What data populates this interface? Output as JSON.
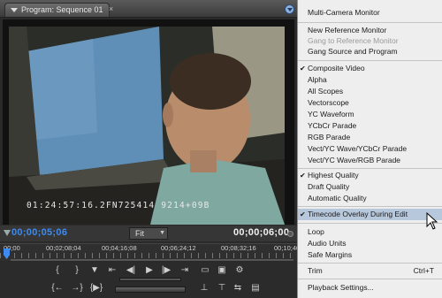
{
  "panel": {
    "tab_label": "Program: Sequence 01",
    "close_glyph": "×"
  },
  "video": {
    "timecode_overlay": "01:24:57:16.2FN725414  9214+09B"
  },
  "time_row": {
    "current_timecode": "00;00;05;06",
    "zoom_value": "Fit",
    "duration_timecode": "00;00;06;00"
  },
  "ruler": {
    "labels": [
      "00;00",
      "00;02;08;04",
      "00;04;16;08",
      "00;06;24;12",
      "00;08;32;16",
      "00;10;40;"
    ]
  },
  "transport": {
    "buttons": {
      "mark_in": "{",
      "mark_out": "}",
      "set_marker": "▼",
      "go_to_in": "⇤",
      "step_back": "◀|",
      "play": "▶",
      "step_forward": "|▶",
      "go_to_out": "⇥",
      "output": "▭",
      "safe_margins": "▣",
      "settings": "⚙",
      "go_prev_marker": "{←",
      "go_next_marker": "→}",
      "play_in_out": "{▶}",
      "loop": "↻",
      "lift": "⊥",
      "extract": "⊤",
      "trim": "⇆",
      "export_frame": "▤"
    }
  },
  "menu": {
    "items": [
      {
        "label": "Multi-Camera Monitor",
        "checked": false,
        "disabled": false
      },
      {
        "label": "New Reference Monitor",
        "checked": false,
        "disabled": false
      },
      {
        "label": "Gang to Reference Monitor",
        "checked": false,
        "disabled": true
      },
      {
        "label": "Gang Source and Program",
        "checked": false,
        "disabled": false
      },
      {
        "label": "Composite Video",
        "checked": true,
        "disabled": false
      },
      {
        "label": "Alpha",
        "checked": false,
        "disabled": false
      },
      {
        "label": "All Scopes",
        "checked": false,
        "disabled": false
      },
      {
        "label": "Vectorscope",
        "checked": false,
        "disabled": false
      },
      {
        "label": "YC Waveform",
        "checked": false,
        "disabled": false
      },
      {
        "label": "YCbCr Parade",
        "checked": false,
        "disabled": false
      },
      {
        "label": "RGB Parade",
        "checked": false,
        "disabled": false
      },
      {
        "label": "Vect/YC Wave/YCbCr Parade",
        "checked": false,
        "disabled": false
      },
      {
        "label": "Vect/YC Wave/RGB Parade",
        "checked": false,
        "disabled": false
      },
      {
        "label": "Highest Quality",
        "checked": true,
        "disabled": false
      },
      {
        "label": "Draft Quality",
        "checked": false,
        "disabled": false
      },
      {
        "label": "Automatic Quality",
        "checked": false,
        "disabled": false
      },
      {
        "label": "Timecode Overlay During Edit",
        "checked": true,
        "disabled": false,
        "highlighted": true
      },
      {
        "label": "Loop",
        "checked": false,
        "disabled": false
      },
      {
        "label": "Audio Units",
        "checked": false,
        "disabled": false
      },
      {
        "label": "Safe Margins",
        "checked": false,
        "disabled": false
      },
      {
        "label": "Trim",
        "checked": false,
        "disabled": false,
        "shortcut": "Ctrl+T"
      },
      {
        "label": "Playback Settings...",
        "checked": false,
        "disabled": false
      }
    ],
    "check_glyph": "✔"
  },
  "colors": {
    "accent_timecode": "#3d8bf0",
    "menu_highlight": "#b8c8dc"
  }
}
